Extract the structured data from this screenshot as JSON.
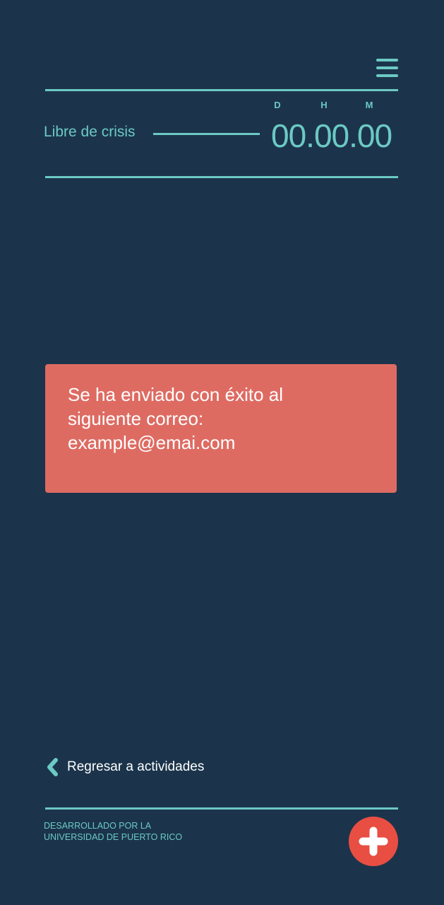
{
  "header": {
    "menu_icon": "hamburger-menu-icon"
  },
  "timer": {
    "label": "Libre de crisis",
    "units": {
      "days": "D",
      "hours": "H",
      "minutes": "M"
    },
    "value": "00.00.00"
  },
  "toast": {
    "line1": "Se ha enviado con éxito al",
    "line2": "siguiente correo:",
    "email": "example@emai.com"
  },
  "nav": {
    "back_icon": "chevron-left-icon",
    "back_label": "Regresar a actividades"
  },
  "footer": {
    "credit_line1": "DESARROLLADO POR LA",
    "credit_line2": "UNIVERSIDAD DE PUERTO RICO",
    "fab_icon": "plus-icon"
  },
  "colors": {
    "background": "#1b344b",
    "accent": "#6cc9c4",
    "toast": "#de6b62",
    "fab": "#e94e43",
    "text_light": "#ffffff"
  }
}
